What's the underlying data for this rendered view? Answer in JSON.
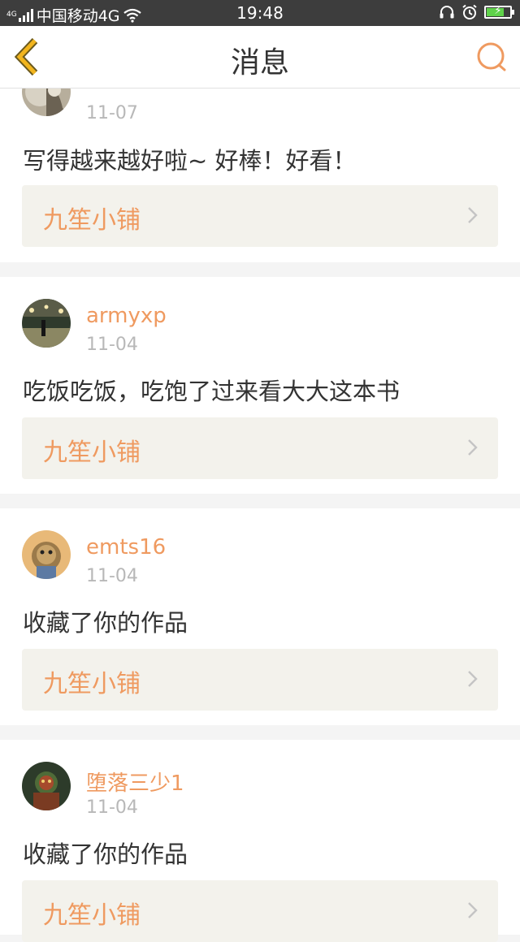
{
  "status_bar": {
    "carrier": "中国移动4G",
    "network_tag": "4G",
    "time": "19:48"
  },
  "header": {
    "title": "消息",
    "back_icon": "chevron-left-icon",
    "search_icon": "search-icon"
  },
  "colors": {
    "accent": "#ef9a60",
    "back_arrow": "#f2b51e",
    "card_link_bg": "#f3f2ec",
    "page_bg": "#f4f4f4"
  },
  "messages": [
    {
      "username": "",
      "date": "11-07",
      "comment": "写得越来越好啦~ 好棒！好看！",
      "shop_name": "九笙小铺"
    },
    {
      "username": "armyxp",
      "date": "11-04",
      "comment": "吃饭吃饭，吃饱了过来看大大这本书",
      "shop_name": "九笙小铺"
    },
    {
      "username": "emts16",
      "date": "11-04",
      "comment": "收藏了你的作品",
      "shop_name": "九笙小铺"
    },
    {
      "username": "堕落三少1",
      "date": "11-04",
      "comment": "收藏了你的作品",
      "shop_name": "九笙小铺"
    }
  ]
}
